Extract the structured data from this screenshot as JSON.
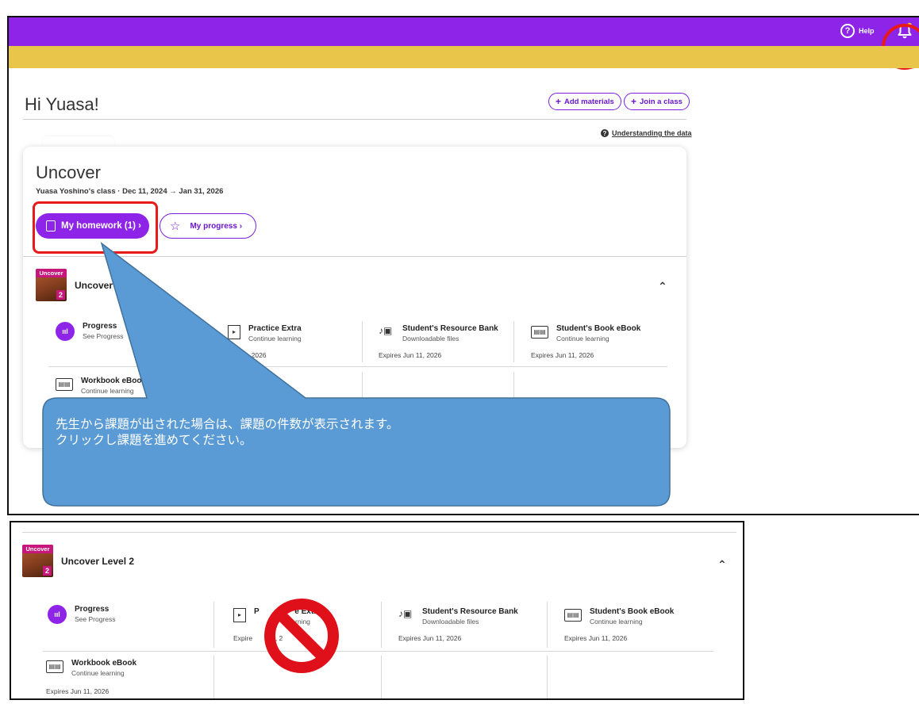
{
  "header": {
    "help_label": "Help",
    "help_glyph": "?"
  },
  "greeting": "Hi Yuasa!",
  "actions": {
    "add_materials": "Add materials",
    "join_class": "Join a class",
    "plus": "+"
  },
  "understanding_link": "Understanding the data",
  "course": {
    "title": "Uncover",
    "class_meta": "Yuasa Yoshino's class · Dec 11, 2024 → Jan 31, 2026",
    "homework_button": "My homework (1) ›",
    "progress_button": "My progress ›",
    "level_name": "Uncover Level 2",
    "level_name_partial": "Uncover L",
    "cover_brand": "Uncover",
    "cover_level": "2"
  },
  "tiles": [
    {
      "title": "Progress",
      "sub": "See Progress",
      "expires": "",
      "icon": "progress-icon"
    },
    {
      "title": "Practice Extra",
      "sub": "Continue learning",
      "expires": "Expires Jun 11, 2026",
      "icon": "video-icon"
    },
    {
      "title": "Student's Resource Bank",
      "sub": "Downloadable files",
      "expires": "Expires Jun 11, 2026",
      "icon": "resource-icon"
    },
    {
      "title": "Student's Book eBook",
      "sub": "Continue learning",
      "expires": "Expires Jun 11, 2026",
      "icon": "book-icon"
    },
    {
      "title": "Workbook eBook",
      "sub": "Continue learning",
      "expires": "Expires Jun 11, 2026",
      "icon": "book-icon"
    }
  ],
  "top_fragments": {
    "practice_expires": "Jun 11, 2026"
  },
  "bottom_fragments": {
    "practice_title_tail": "e Extra",
    "practice_title_head": "P",
    "practice_sub_tail": "rning",
    "practice_expires_head": "Expire",
    "practice_expires_tail": "11, 2"
  },
  "callout": {
    "line1": "先生から課題が出された場合は、課題の件数が表示されます。",
    "line2": "クリックし課題を進めてください。"
  },
  "colors": {
    "brand_purple": "#8e24e8",
    "banner_yellow": "#e9c549",
    "annotation_red": "#e81919",
    "callout_blue": "#5b9bd5"
  }
}
